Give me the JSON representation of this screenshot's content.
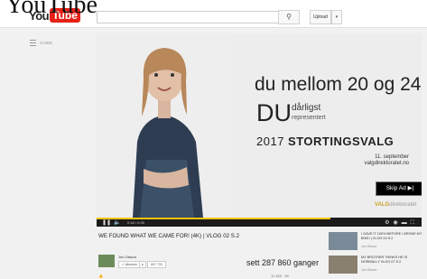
{
  "page_heading": "YouTube",
  "header": {
    "logo_you": "You",
    "logo_tube": "Tube",
    "search_placeholder": "",
    "search_button_icon": "search-icon",
    "upload_label": "Upload",
    "upload_caret_icon": "chevron-down-icon"
  },
  "guide": {
    "label": "GUIDE"
  },
  "ad": {
    "line1": "du mellom 20 og 24",
    "du": "DU",
    "du_word1": "dårligst",
    "du_word2": "representert",
    "year": "2017",
    "election": "STORTINGSVALG",
    "date": "11. september",
    "site": "valgdirektoratet.no",
    "skip_label": "Skip Ad ▶|",
    "brand_prefix": "VALG",
    "brand_suffix": "direktoratet"
  },
  "player": {
    "time": "0:18 / 0:25",
    "progress": 0.72,
    "accent": "#f1c40f"
  },
  "video": {
    "title": "WE FOUND WHAT WE CAME FOR! (4K) | VLOG 02 S.2",
    "channel": "Jon Olsson",
    "subscribe_label": "Abonner",
    "subscribe_count": "697 733",
    "views": "sett 287 860 ganger",
    "likes": "11 469",
    "dislikes": "96"
  },
  "related": [
    {
      "title": "I GAVE IT 100% BEFORE I BROKE MY BIKE! | VLOG 03 S.2",
      "meta": "Jon Olsson"
    },
    {
      "title": "MY BROTHER THINKS HE IS NORMALLY VLOG 07 S.2",
      "meta": "Jon Olsson"
    }
  ]
}
